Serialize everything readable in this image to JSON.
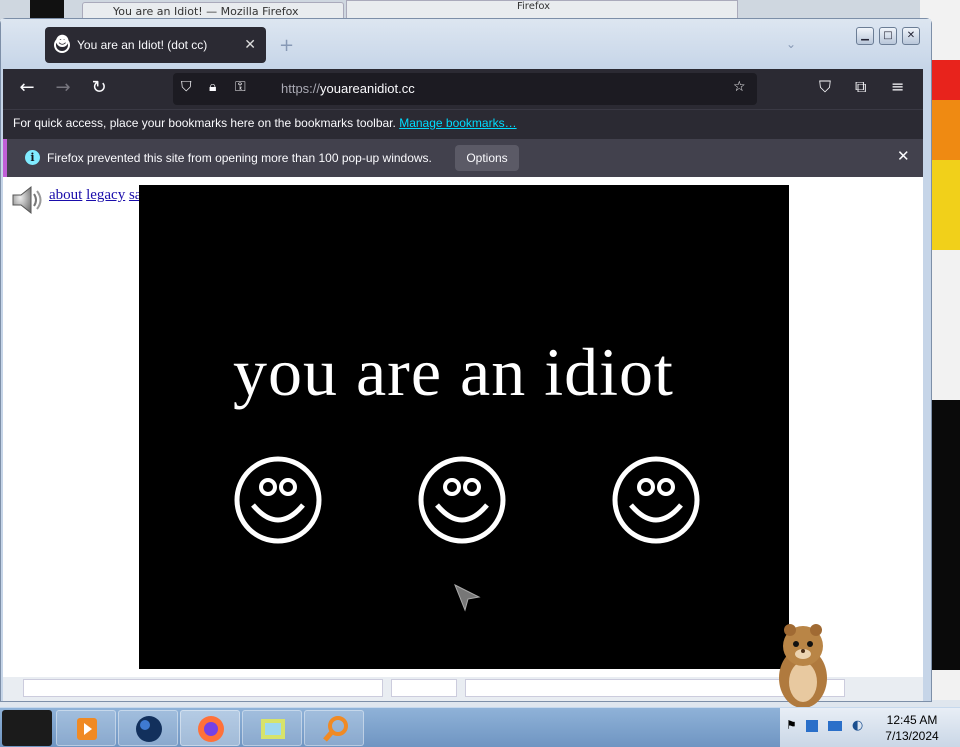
{
  "background": {
    "tab_title": "You are an Idiot! — Mozilla Firefox",
    "second_window_title": "Firefox"
  },
  "window": {
    "tab_title": "You are an Idiot! (dot cc)",
    "tab_close_icon": "close-icon",
    "controls": [
      "minimize-icon",
      "maximize-icon",
      "close-icon"
    ]
  },
  "toolbar": {
    "back_icon": "back-arrow-icon",
    "forward_icon": "forward-arrow-icon",
    "reload_icon": "reload-icon",
    "url_protocol": "https://",
    "url_host": "youareanidiot.cc",
    "right_icons": [
      "pocket-icon",
      "extensions-icon",
      "menu-icon"
    ],
    "bookmark_star_icon": "star-icon"
  },
  "bookmarks_bar": {
    "message": "For quick access, place your bookmarks here on the bookmarks toolbar.",
    "link": "Manage bookmarks…"
  },
  "notification": {
    "message": "Firefox prevented this site from opening more than 100 pop-up windows.",
    "options_label": "Options",
    "accent": "#c05fd6"
  },
  "page": {
    "links": [
      "about",
      "legacy",
      "safe"
    ],
    "headline": "you are an idiot",
    "smiley_count": 3
  },
  "taskbar": {
    "time": "12:45 AM",
    "date": "7/13/2024"
  }
}
